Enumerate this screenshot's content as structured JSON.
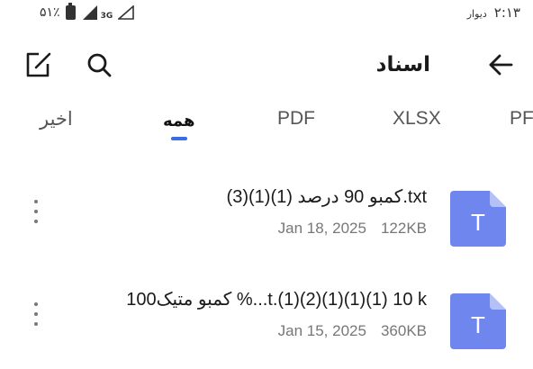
{
  "status_bar": {
    "time": "۲:۱۳",
    "carrier": "دیوار",
    "battery_text": "۵۱٪",
    "network": "3G"
  },
  "app_bar": {
    "title": "اسناد",
    "back_icon": "arrow-back-icon",
    "search_icon": "search-icon",
    "edit_icon": "edit-icon"
  },
  "tabs": [
    {
      "label": "اخیر",
      "active": false
    },
    {
      "label": "همه",
      "active": true
    },
    {
      "label": "PDF",
      "active": false
    },
    {
      "label": "XLSX",
      "active": false
    },
    {
      "label": "PF",
      "active": false
    }
  ],
  "files": [
    {
      "name": "کمبو 90 درصد (1)(1)(3).txt",
      "date": "Jan 18, 2025",
      "size": "122KB",
      "icon_letter": "T"
    },
    {
      "name": "کمبو متیک100  %...t.(1)(2)(1)(1)(1) 10 k",
      "date": "Jan 15, 2025",
      "size": "360KB",
      "icon_letter": "T"
    }
  ],
  "colors": {
    "accent": "#3b6de6",
    "file_icon": "#6f86ef",
    "file_icon_fold": "#b3c1f7"
  }
}
